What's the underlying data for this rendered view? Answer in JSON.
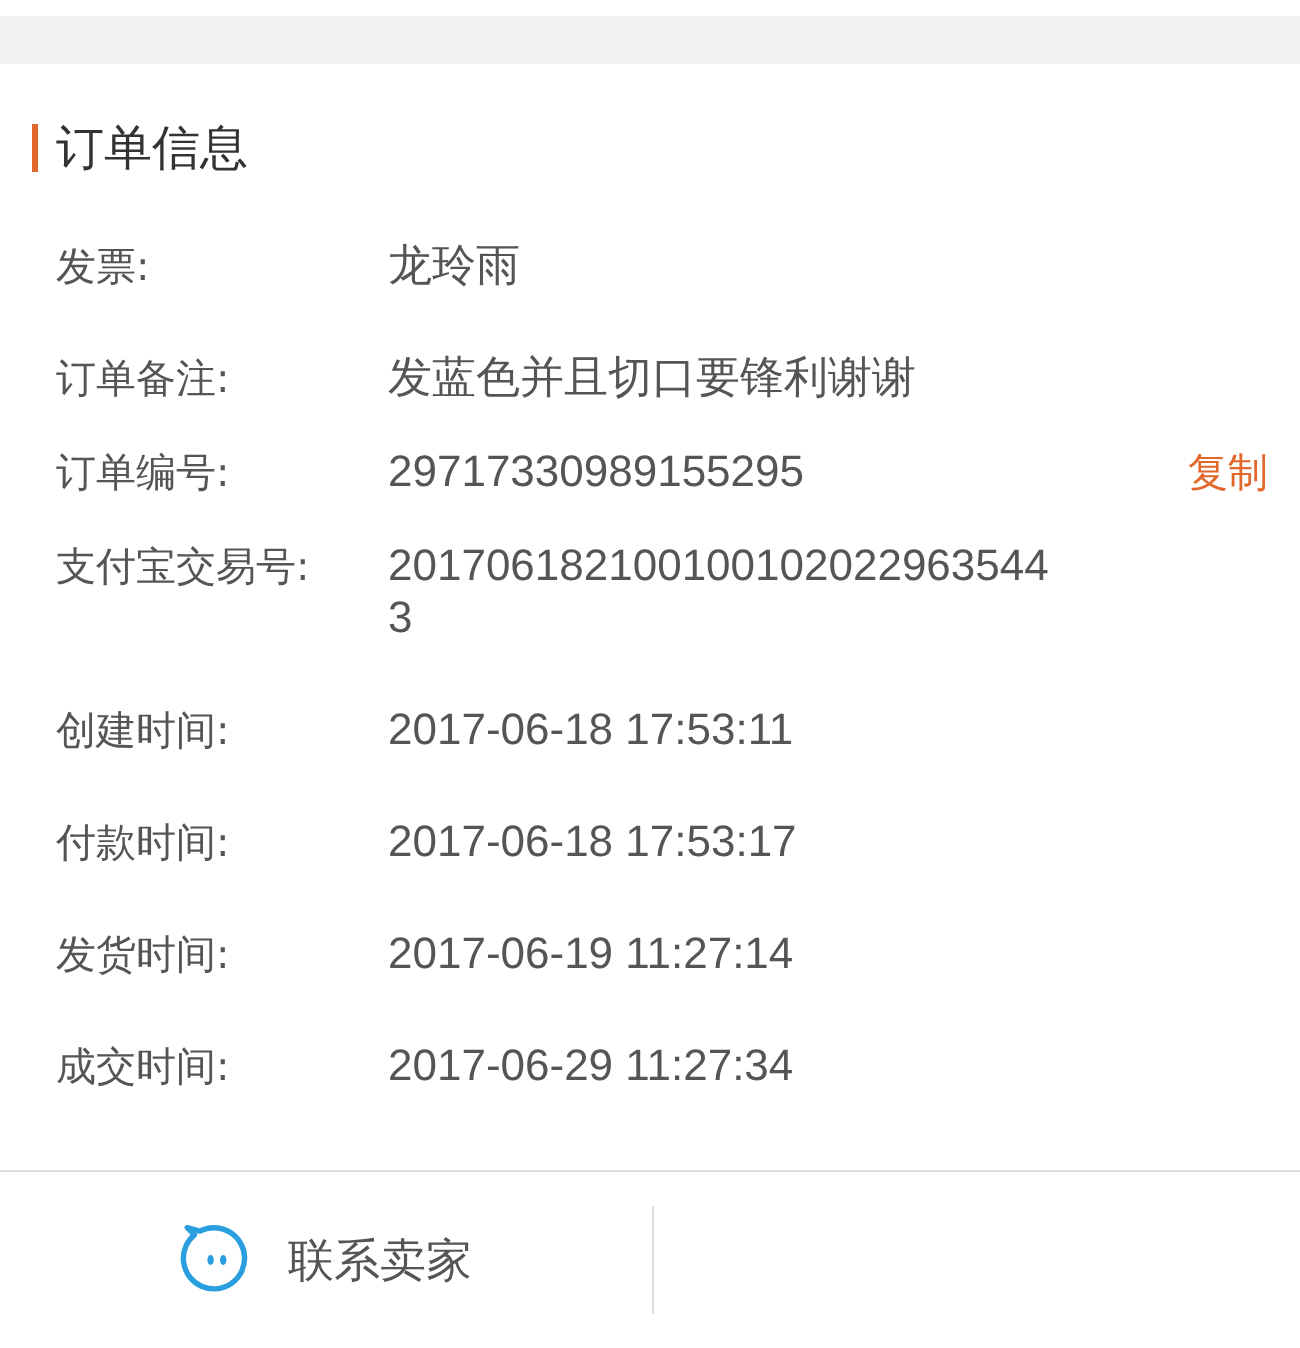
{
  "section_title": "订单信息",
  "rows": [
    {
      "label": "发票:",
      "value": "龙玲雨"
    },
    {
      "label": "订单备注:",
      "value": "发蓝色并且切口要锋利谢谢"
    },
    {
      "label": "订单编号:",
      "value": "29717330989155295",
      "action": "复制"
    },
    {
      "label": "支付宝交易号:",
      "value": "2017061821001001020229635443"
    },
    {
      "label": "创建时间:",
      "value": "2017-06-18 17:53:11"
    },
    {
      "label": "付款时间:",
      "value": "2017-06-18 17:53:17"
    },
    {
      "label": "发货时间:",
      "value": "2017-06-19 11:27:14"
    },
    {
      "label": "成交时间:",
      "value": "2017-06-29 11:27:34"
    }
  ],
  "footer": {
    "contact_button": "联系卖家"
  }
}
